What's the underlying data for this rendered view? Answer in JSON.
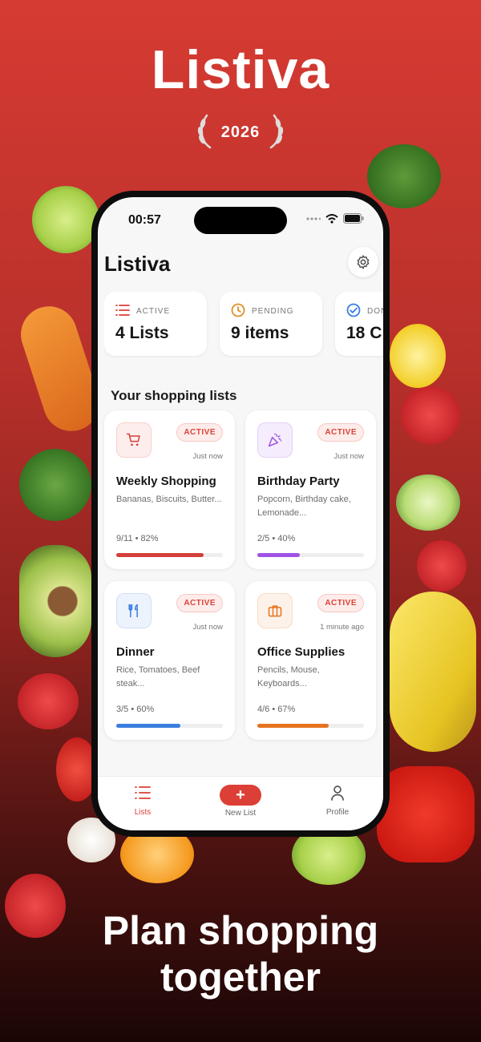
{
  "hero": {
    "title": "Listiva",
    "award_year": "2026"
  },
  "status_bar": {
    "time": "00:57"
  },
  "app": {
    "title": "Listiva"
  },
  "stats": [
    {
      "icon": "list-icon",
      "label": "ACTIVE",
      "value": "4 Lists",
      "color": "#dc3f35"
    },
    {
      "icon": "clock-icon",
      "label": "PENDING",
      "value": "9 items",
      "color": "#e0902a"
    },
    {
      "icon": "check-circle-icon",
      "label": "DONE",
      "value": "18 C",
      "color": "#3a7ee0"
    }
  ],
  "section": {
    "title": "Your shopping lists"
  },
  "lists": [
    {
      "icon": "cart-icon",
      "name": "Weekly Shopping",
      "badge": "ACTIVE",
      "time": "Just now",
      "items": "Bananas, Biscuits, Butter...",
      "progress_text": "9/11 • 82%",
      "progress": 0.82,
      "color": "#d2403a",
      "icon_bg": "#fdeeed"
    },
    {
      "icon": "party-icon",
      "name": "Birthday Party",
      "badge": "ACTIVE",
      "time": "Just now",
      "items": "Popcorn, Birthday cake, Lemonade...",
      "progress_text": "2/5 • 40%",
      "progress": 0.4,
      "color": "#a052e6",
      "icon_bg": "#f5edfd"
    },
    {
      "icon": "fork-knife-icon",
      "name": "Dinner",
      "badge": "ACTIVE",
      "time": "Just now",
      "items": "Rice, Tomatoes, Beef steak...",
      "progress_text": "3/5 • 60%",
      "progress": 0.6,
      "color": "#3a7ee0",
      "icon_bg": "#edf3fd"
    },
    {
      "icon": "briefcase-icon",
      "name": "Office Supplies",
      "badge": "ACTIVE",
      "time": "1 minute ago",
      "items": "Pencils, Mouse, Keyboards...",
      "progress_text": "4/6 • 67%",
      "progress": 0.67,
      "color": "#e5741f",
      "icon_bg": "#fdf2ea"
    }
  ],
  "tabs": [
    {
      "icon": "list-icon",
      "label": "Lists",
      "active": true
    },
    {
      "icon": "plus-icon",
      "label": "New List",
      "active": false
    },
    {
      "icon": "person-icon",
      "label": "Profile",
      "active": false
    }
  ],
  "tagline": {
    "line1": "Plan shopping",
    "line2": "together"
  },
  "colors": {
    "brand": "#dc3f35",
    "background_top": "#d63b32",
    "background_bottom": "#1a0605"
  }
}
